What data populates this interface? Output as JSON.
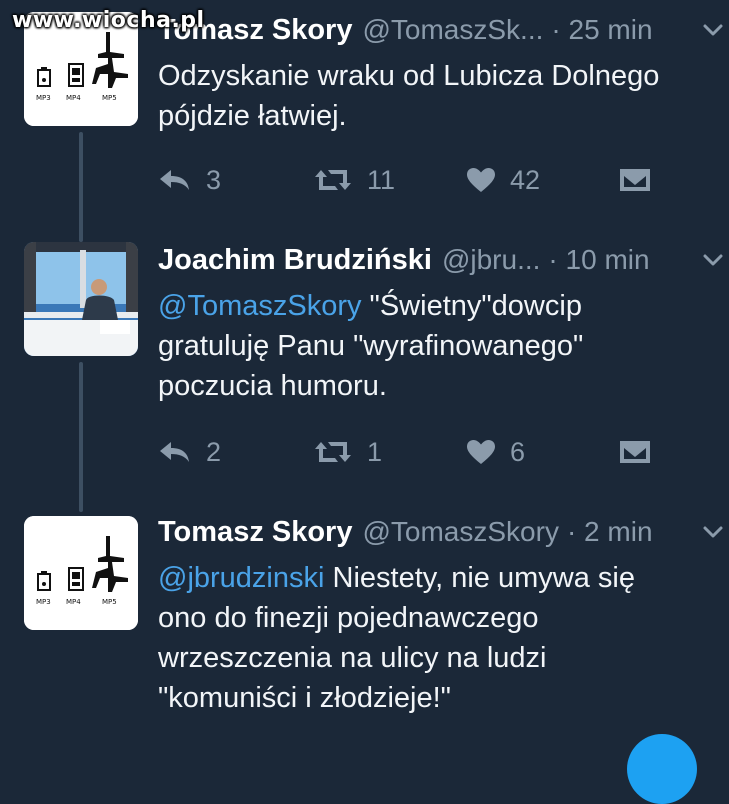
{
  "watermark": "www.wiocha.pl",
  "tweets": [
    {
      "name": "Tomasz Skory",
      "handle": "@TomaszSk...",
      "time": "· 25 min",
      "mention": "",
      "text": "Odzyskanie wraku od Lubicza Dolnego\npójdzie łatwiej.",
      "reply_count": "3",
      "retweet_count": "11",
      "like_count": "42",
      "avatar": {
        "labels": [
          "MP3",
          "MP4",
          "MP5"
        ]
      }
    },
    {
      "name": "Joachim Brudziński",
      "handle": "@jbru...",
      "time": "· 10 min",
      "mention": "@TomaszSkory",
      "text": " \"Świetny\"dowcip\ngratuluję Panu \"wyrafinowanego\"\npoczucia humoru.",
      "reply_count": "2",
      "retweet_count": "1",
      "like_count": "6"
    },
    {
      "name": "Tomasz Skory",
      "handle": "@TomaszSkory",
      "time": "· 2 min",
      "mention": "@jbrudzinski",
      "text": " Niestety, nie umywa się\nono do finezji pojednawczego\nwrzeszczenia na ulicy na ludzi\n\"komuniści i złodzieje!\"",
      "avatar": {
        "labels": [
          "MP3",
          "MP4",
          "MP5"
        ]
      }
    }
  ],
  "colors": {
    "background": "#1b2838",
    "mention": "#4aa3e8",
    "meta": "#8b9bab",
    "thread_line": "#3d4f62"
  },
  "icons": [
    "reply-icon",
    "retweet-icon",
    "like-icon",
    "direct-message-icon",
    "chevron-down-icon"
  ]
}
